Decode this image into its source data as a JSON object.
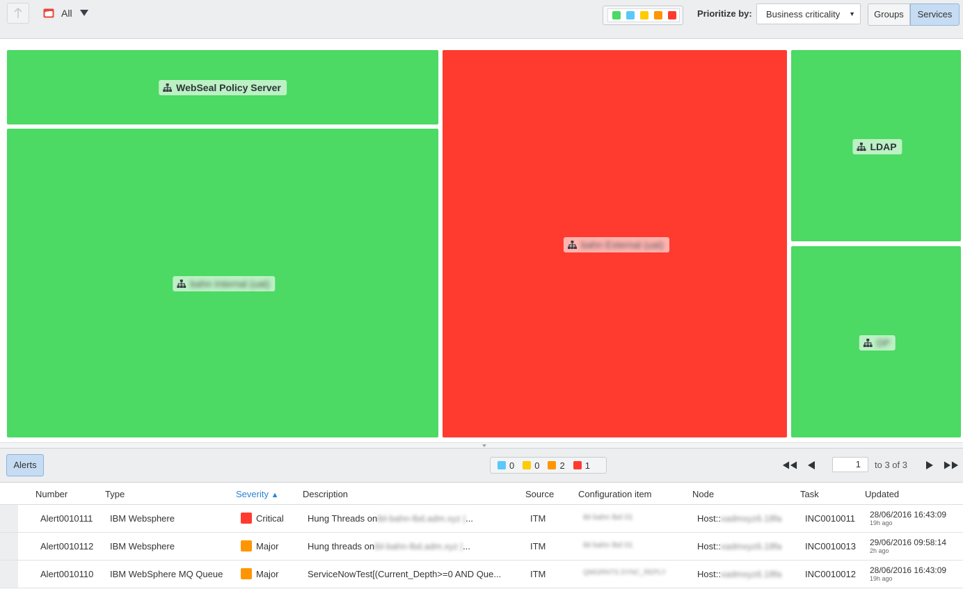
{
  "toolbar": {
    "filter_label": "All",
    "legend_colors": [
      "#4cd964",
      "#5ac8fa",
      "#ffcc00",
      "#ff9500",
      "#ff3b30"
    ],
    "prioritize_label": "Prioritize by:",
    "prioritize_value": "Business criticality",
    "groups_label": "Groups",
    "services_label": "Services"
  },
  "colors": {
    "healthy": "#4cd964",
    "critical": "#ff3b30",
    "major": "#ff9500",
    "minor": "#ffcc00",
    "warning": "#5ac8fa",
    "accent": "#2784d6"
  },
  "treemap": {
    "tiles": [
      {
        "label": "WebSeal Policy Server",
        "status": "healthy",
        "blurred": false
      },
      {
        "label": "bahn Internal (uat)",
        "status": "healthy",
        "blurred": true
      },
      {
        "label": "bahn External (uat)",
        "status": "critical",
        "blurred": true
      },
      {
        "label": "LDAP",
        "status": "healthy",
        "blurred": false
      },
      {
        "label": "DP",
        "status": "healthy",
        "blurred": true
      }
    ]
  },
  "alerts_bar": {
    "button_label": "Alerts",
    "counts": [
      {
        "color": "#5ac8fa",
        "value": "0"
      },
      {
        "color": "#ffcc00",
        "value": "0"
      },
      {
        "color": "#ff9500",
        "value": "2"
      },
      {
        "color": "#ff3b30",
        "value": "1"
      }
    ],
    "page_value": "1",
    "page_of": "to 3 of 3"
  },
  "table": {
    "columns": [
      "Number",
      "Type",
      "Severity",
      "Description",
      "Source",
      "Configuration item",
      "Node",
      "Task",
      "Updated"
    ],
    "sorted_column": "Severity",
    "rows": [
      {
        "number": "Alert0010111",
        "type": "IBM Websphere",
        "severity": "Critical",
        "severity_color": "#ff3b30",
        "description": "Hung Threads on",
        "description_blur": "ibl-bahn-lbd.adm.xyz |",
        "description_end": "...",
        "source": "ITM",
        "ci": "ibl bahn lbd 01",
        "node_prefix": "Host::",
        "node_blur": "xadmxyz6.18fa",
        "task": "INC0010011",
        "updated": "28/06/2016 16:43:09",
        "updated_ago": "19h ago"
      },
      {
        "number": "Alert0010112",
        "type": "IBM Websphere",
        "severity": "Major",
        "severity_color": "#ff9500",
        "description": "Hung threads on",
        "description_blur": "ibl-bahn-lbd.adm.xyz |",
        "description_end": "...",
        "source": "ITM",
        "ci": "ibl bahn lbd 01",
        "node_prefix": "Host::",
        "node_blur": "xadmxyz6.18fa",
        "task": "INC0010013",
        "updated": "29/06/2016 09:58:14",
        "updated_ago": "2h ago"
      },
      {
        "number": "Alert0010110",
        "type": "IBM WebSphere MQ Queue",
        "severity": "Major",
        "severity_color": "#ff9500",
        "description": "ServiceNowTest[(Current_Depth>=0 AND Que",
        "description_blur": "",
        "description_end": "...",
        "source": "ITM",
        "ci": "QMGRNTS.SYNC_REPLY",
        "node_prefix": "Host::",
        "node_blur": "xadmxyz6.18fa",
        "task": "INC0010012",
        "updated": "28/06/2016 16:43:09",
        "updated_ago": "19h ago"
      }
    ]
  }
}
